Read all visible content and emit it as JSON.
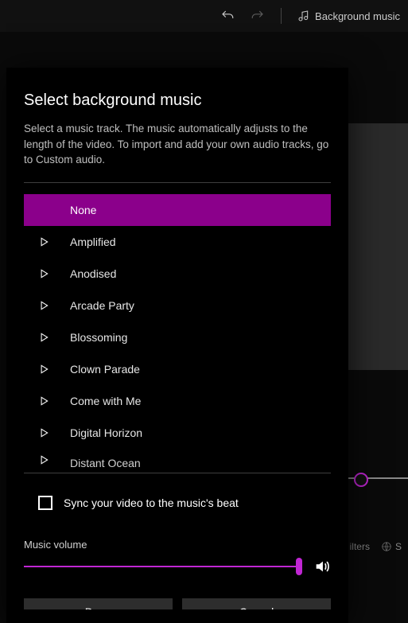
{
  "topbar": {
    "undo_tooltip": "Undo",
    "redo_tooltip": "Redo",
    "bgmusic_label": "Background music"
  },
  "bg": {
    "filters_label": "ilters",
    "other_label": "S"
  },
  "dialog": {
    "title": "Select background music",
    "description": "Select a music track. The music automatically adjusts to the length of the video. To import and add your own audio tracks, go to Custom audio.",
    "tracks": [
      {
        "name": "None",
        "selected": true
      },
      {
        "name": "Amplified",
        "selected": false
      },
      {
        "name": "Anodised",
        "selected": false
      },
      {
        "name": "Arcade Party",
        "selected": false
      },
      {
        "name": "Blossoming",
        "selected": false
      },
      {
        "name": "Clown Parade",
        "selected": false
      },
      {
        "name": "Come with Me",
        "selected": false
      },
      {
        "name": "Digital Horizon",
        "selected": false
      },
      {
        "name": "Distant Ocean",
        "selected": false
      }
    ],
    "sync_label": "Sync your video to the music's beat",
    "sync_checked": false,
    "volume_label": "Music volume",
    "volume_percent": 100,
    "done_label": "Done",
    "cancel_label": "Cancel",
    "accent_color": "#8b008b",
    "slider_color": "#c026d3"
  }
}
